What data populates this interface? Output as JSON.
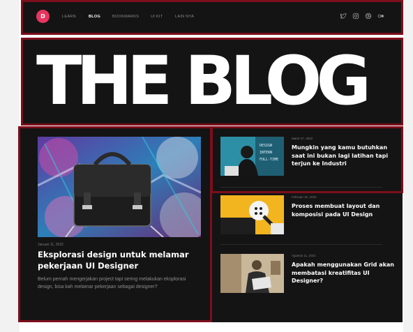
{
  "nav": {
    "logo_letter": "D",
    "links": [
      "LEARN",
      "BLOG",
      "BOOKMARKS",
      "UI KIT",
      "LAIN NYA"
    ],
    "active": "BLOG",
    "social_icons": [
      "twitter-icon",
      "instagram-icon",
      "dribbble-icon",
      "flickr-icon"
    ]
  },
  "hero": {
    "title": "THE BLOG"
  },
  "featured": {
    "date": "Januari 11, 2022",
    "title": "Eksplorasi design untuk melamar pekerjaan UI Designer",
    "description": "Belum pernah mengerjakan project tapi sering melakukan eksplorasi design, bisa kah melamar pekerjaan sebagai designer?"
  },
  "posts": [
    {
      "date": "Maret 27, 2022",
      "title": "Mungkin yang kamu butuhkan saat ini bukan lagi latihan tapi terjun ke Industri"
    },
    {
      "date": "Februari 15, 2022",
      "title": "Proses membuat layout dan komposisi pada UI Design"
    },
    {
      "date": "Agustus 11, 2021",
      "title": "Apakah menggunakan Grid akan membatasi kreatifitas UI Designer?"
    }
  ],
  "colors": {
    "background": "#141414",
    "accent": "#e8355f",
    "outline": "#7d0e1c"
  }
}
